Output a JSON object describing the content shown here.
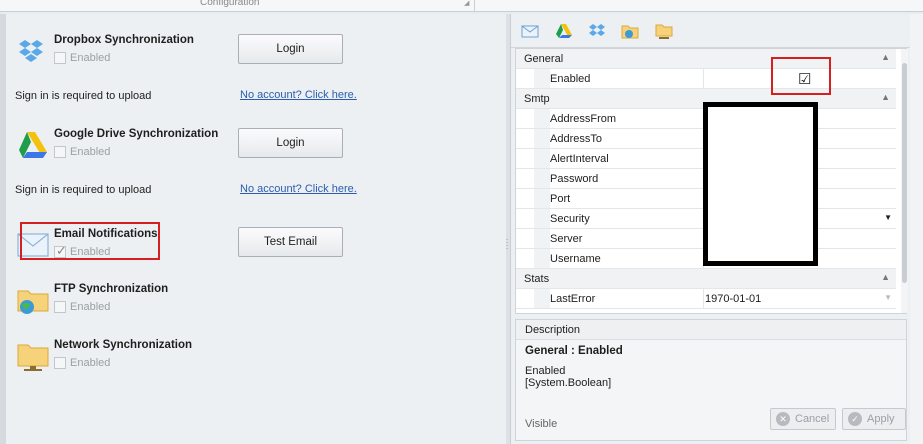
{
  "header": {
    "configuration_label": "Configuration"
  },
  "services": [
    {
      "title": "Dropbox Synchronization",
      "enabled_label": "Enabled",
      "enabled": false,
      "icon": "dropbox-icon"
    },
    {
      "title": "Google Drive Synchronization",
      "enabled_label": "Enabled",
      "enabled": false,
      "icon": "google-drive-icon"
    },
    {
      "title": "Email Notifications",
      "enabled_label": "Enabled",
      "enabled": true,
      "icon": "email-icon"
    },
    {
      "title": "FTP Synchronization",
      "enabled_label": "Enabled",
      "enabled": false,
      "icon": "ftp-folder-icon"
    },
    {
      "title": "Network Synchronization",
      "enabled_label": "Enabled",
      "enabled": false,
      "icon": "network-folder-icon"
    }
  ],
  "buttons": {
    "dropbox_login": "Login",
    "gdrive_login": "Login",
    "test_email": "Test Email"
  },
  "notes": {
    "dropbox_signin": "Sign in is required to upload",
    "dropbox_link": "No account? Click here.",
    "gdrive_signin": "Sign in is required to upload",
    "gdrive_link": "No account? Click here."
  },
  "toolbar_icons": [
    "email-icon",
    "google-drive-icon",
    "dropbox-icon",
    "ftp-icon",
    "network-icon"
  ],
  "property_grid": {
    "categories": [
      {
        "name": "General",
        "properties": [
          {
            "name": "Enabled",
            "value": "☑"
          }
        ]
      },
      {
        "name": "Smtp",
        "properties": [
          {
            "name": "AddressFrom",
            "value": ""
          },
          {
            "name": "AddressTo",
            "value": ""
          },
          {
            "name": "AlertInterval",
            "value": ""
          },
          {
            "name": "Password",
            "value": ""
          },
          {
            "name": "Port",
            "value": ""
          },
          {
            "name": "Security",
            "value": ""
          },
          {
            "name": "Server",
            "value": ""
          },
          {
            "name": "Username",
            "value": ""
          }
        ]
      },
      {
        "name": "Stats",
        "properties": [
          {
            "name": "LastError",
            "value": "1970-01-01"
          }
        ]
      }
    ]
  },
  "description": {
    "header": "Description",
    "property": "General : Enabled",
    "line1": "Enabled",
    "line2": "[System.Boolean]",
    "visible_label": "Visible",
    "cancel_label": "Cancel",
    "apply_label": "Apply"
  },
  "colors": {
    "highlight_red": "#d42020",
    "link_blue": "#2a5db0",
    "redaction_black": "#000000"
  }
}
